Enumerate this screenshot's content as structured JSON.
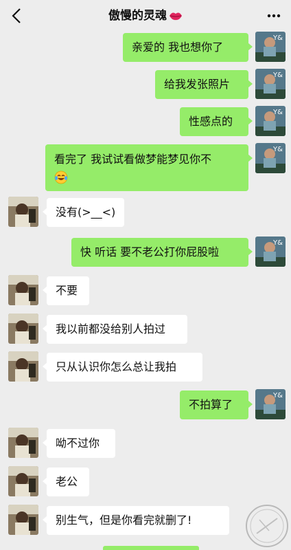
{
  "header": {
    "title": "傲慢的灵魂",
    "back_icon": "chevron-left-icon",
    "more_icon": "more-dots-icon",
    "emoji_icon": "lips-emoji-icon"
  },
  "messages": [
    {
      "from": "me",
      "text": "亲爱的 我也想你了"
    },
    {
      "from": "me",
      "text": "给我发张照片"
    },
    {
      "from": "me",
      "text": "性感点的"
    },
    {
      "from": "me",
      "text": "看完了 我试试看做梦能梦见你不",
      "emoji": "laugh-cry-emoji-icon"
    },
    {
      "from": "other",
      "text": "没有(>__<)"
    },
    {
      "from": "me",
      "text": "快 听话  要不老公打你屁股啦"
    },
    {
      "from": "other",
      "text": "不要"
    },
    {
      "from": "other",
      "text": "我以前都没给别人拍过"
    },
    {
      "from": "other",
      "text": "只从认识你怎么总让我拍"
    },
    {
      "from": "me",
      "text": "不拍算了"
    },
    {
      "from": "other",
      "text": "呦不过你"
    },
    {
      "from": "other",
      "text": "老公"
    },
    {
      "from": "other",
      "text": "别生气，但是你看完就删了!"
    }
  ],
  "colors": {
    "background": "#ededed",
    "my_bubble": "#95ec69",
    "their_bubble": "#ffffff"
  }
}
